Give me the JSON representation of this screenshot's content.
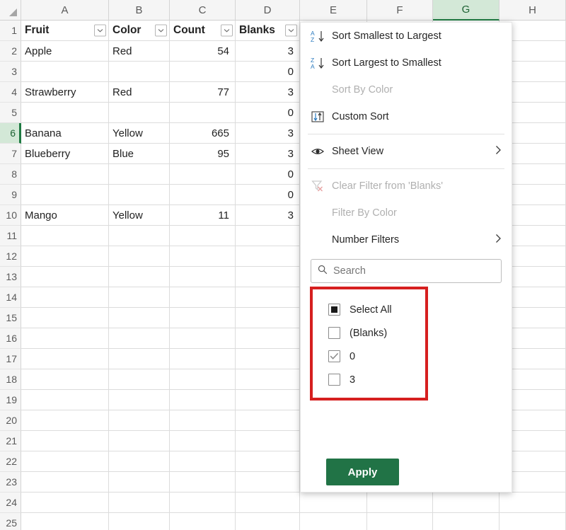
{
  "spreadsheet": {
    "column_headers": [
      "A",
      "B",
      "C",
      "D",
      "E",
      "F",
      "G",
      "H"
    ],
    "active_column": "G",
    "active_row": "6",
    "row_numbers": [
      "1",
      "2",
      "3",
      "4",
      "5",
      "6",
      "7",
      "8",
      "9",
      "10",
      "11",
      "12",
      "13",
      "14",
      "15",
      "16",
      "17",
      "18",
      "19",
      "20",
      "21",
      "22",
      "23",
      "24",
      "25"
    ],
    "table_headers": [
      "Fruit",
      "Color",
      "Count",
      "Blanks"
    ],
    "rows": [
      {
        "row": "2",
        "fruit": "Apple",
        "color": "Red",
        "count": "54",
        "blanks": "3"
      },
      {
        "row": "3",
        "fruit": "",
        "color": "",
        "count": "",
        "blanks": "0"
      },
      {
        "row": "4",
        "fruit": "Strawberry",
        "color": "Red",
        "count": "77",
        "blanks": "3"
      },
      {
        "row": "5",
        "fruit": "",
        "color": "",
        "count": "",
        "blanks": "0"
      },
      {
        "row": "6",
        "fruit": "Banana",
        "color": "Yellow",
        "count": "665",
        "blanks": "3"
      },
      {
        "row": "7",
        "fruit": "Blueberry",
        "color": "Blue",
        "count": "95",
        "blanks": "3"
      },
      {
        "row": "8",
        "fruit": "",
        "color": "",
        "count": "",
        "blanks": "0"
      },
      {
        "row": "9",
        "fruit": "",
        "color": "",
        "count": "",
        "blanks": "0"
      },
      {
        "row": "10",
        "fruit": "Mango",
        "color": "Yellow",
        "count": "11",
        "blanks": "3"
      }
    ]
  },
  "filter_menu": {
    "sort_items": [
      {
        "label": "Sort Smallest to Largest",
        "icon": "sort-az-icon",
        "disabled": false
      },
      {
        "label": "Sort Largest to Smallest",
        "icon": "sort-za-icon",
        "disabled": false
      },
      {
        "label": "Sort By Color",
        "icon": "none",
        "disabled": true
      },
      {
        "label": "Custom Sort",
        "icon": "custom-sort-icon",
        "disabled": false
      }
    ],
    "sheet_view": {
      "label": "Sheet View",
      "icon": "eye-icon",
      "has_submenu": true
    },
    "filter_items": [
      {
        "label": "Clear Filter from 'Blanks'",
        "icon": "clear-filter-icon",
        "disabled": true,
        "has_submenu": false
      },
      {
        "label": "Filter By Color",
        "icon": "none",
        "disabled": true,
        "has_submenu": false
      },
      {
        "label": "Number Filters",
        "icon": "none",
        "disabled": false,
        "has_submenu": true
      }
    ],
    "search": {
      "placeholder": "Search",
      "value": "",
      "icon": "search-icon"
    },
    "checkboxes": [
      {
        "label": "Select All",
        "state": "partial"
      },
      {
        "label": "(Blanks)",
        "state": "unchecked"
      },
      {
        "label": "0",
        "state": "checked"
      },
      {
        "label": "3",
        "state": "unchecked"
      }
    ],
    "apply_label": "Apply",
    "accent_color": "#217346",
    "highlight_color": "#d61f1f"
  }
}
